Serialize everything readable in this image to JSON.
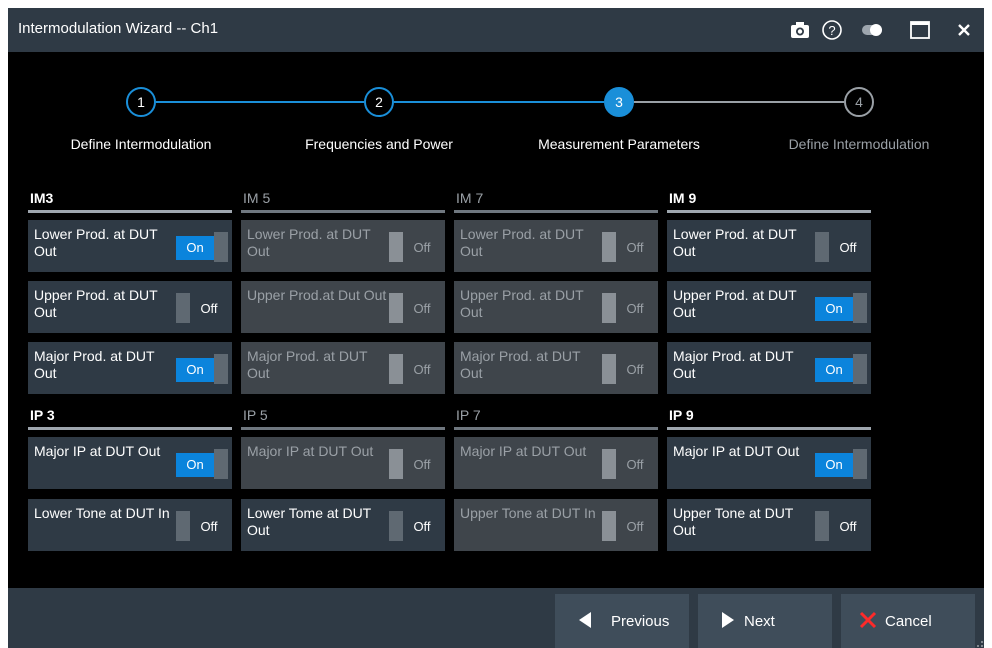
{
  "window": {
    "title": "Intermodulation Wizard -- Ch1"
  },
  "titlebar_icons": [
    "camera-icon",
    "help-icon",
    "toggle-theme-icon",
    "maximize-icon",
    "close-icon"
  ],
  "stepper": {
    "steps": [
      {
        "number": "1",
        "label": "Define Intermodulation",
        "state": "done"
      },
      {
        "number": "2",
        "label": "Frequencies and Power",
        "state": "done"
      },
      {
        "number": "3",
        "label": "Measurement Parameters",
        "state": "active"
      },
      {
        "number": "4",
        "label": "Define Intermodulation",
        "state": "todo"
      }
    ]
  },
  "im_groups": [
    {
      "title": "IM3",
      "enabled": true,
      "items": [
        {
          "label": "Lower Prod. at DUT Out",
          "state": "On"
        },
        {
          "label": "Upper Prod. at DUT Out",
          "state": "Off"
        },
        {
          "label": "Major Prod. at DUT Out",
          "state": "On"
        }
      ]
    },
    {
      "title": "IM 5",
      "enabled": false,
      "items": [
        {
          "label": "Lower Prod. at DUT Out",
          "state": "Off"
        },
        {
          "label": "Upper Prod.at Dut Out",
          "state": "Off"
        },
        {
          "label": "Major Prod. at DUT Out",
          "state": "Off"
        }
      ]
    },
    {
      "title": "IM 7",
      "enabled": false,
      "items": [
        {
          "label": "Lower Prod. at DUT Out",
          "state": "Off"
        },
        {
          "label": "Upper Prod. at DUT Out",
          "state": "Off"
        },
        {
          "label": "Major Prod. at DUT Out",
          "state": "Off"
        }
      ]
    },
    {
      "title": "IM 9",
      "enabled": true,
      "items": [
        {
          "label": "Lower Prod. at DUT Out",
          "state": "Off"
        },
        {
          "label": "Upper Prod. at DUT Out",
          "state": "On"
        },
        {
          "label": "Major Prod. at DUT Out",
          "state": "On"
        }
      ]
    }
  ],
  "ip_groups": [
    {
      "title": "IP 3",
      "enabled": true,
      "items": [
        {
          "label": "Major IP at DUT Out",
          "state": "On",
          "enabled": true
        },
        {
          "label": "Lower Tone at DUT In",
          "state": "Off",
          "enabled": true
        }
      ]
    },
    {
      "title": "IP 5",
      "enabled": false,
      "items": [
        {
          "label": "Major IP at DUT Out",
          "state": "Off",
          "enabled": false
        },
        {
          "label": "Lower Tome at DUT Out",
          "state": "Off",
          "enabled": true
        }
      ]
    },
    {
      "title": "IP 7",
      "enabled": false,
      "items": [
        {
          "label": "Major IP at DUT Out",
          "state": "Off",
          "enabled": false
        },
        {
          "label": "Upper Tone at DUT In",
          "state": "Off",
          "enabled": false
        }
      ]
    },
    {
      "title": "IP 9",
      "enabled": true,
      "items": [
        {
          "label": "Major IP at DUT Out",
          "state": "On",
          "enabled": true
        },
        {
          "label": "Upper Tone at DUT Out",
          "state": "Off",
          "enabled": true
        }
      ]
    }
  ],
  "footer": {
    "previous_label": "Previous",
    "next_label": "Next",
    "cancel_label": "Cancel"
  },
  "colors": {
    "accent": "#1a8fd9",
    "on_fill": "#0b84dc",
    "cancel_x": "#ff2a2a",
    "panel": "#2f3a45"
  }
}
